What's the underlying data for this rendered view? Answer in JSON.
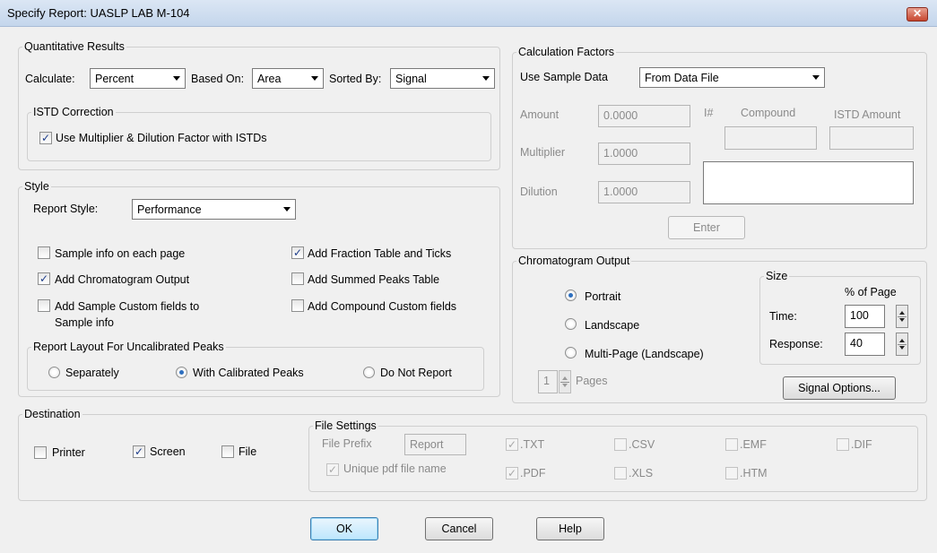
{
  "window": {
    "title": "Specify Report: UASLP LAB M-104",
    "close_glyph": "✕"
  },
  "quant": {
    "legend": "Quantitative Results",
    "calculate_label": "Calculate:",
    "calculate_value": "Percent",
    "based_on_label": "Based On:",
    "based_on_value": "Area",
    "sorted_by_label": "Sorted By:",
    "sorted_by_value": "Signal",
    "istd_legend": "ISTD Correction",
    "istd_check_label": "Use Multiplier & Dilution Factor with ISTDs",
    "istd_checked": true
  },
  "style": {
    "legend": "Style",
    "report_style_label": "Report Style:",
    "report_style_value": "Performance",
    "sample_info": "Sample info on each page",
    "add_chrom": "Add Chromatogram Output",
    "add_sample_custom_1": "Add Sample Custom fields to",
    "add_sample_custom_2": "Sample info",
    "add_fraction": "Add Fraction Table and Ticks",
    "add_summed": "Add Summed Peaks Table",
    "add_compound_custom": "Add Compound Custom fields",
    "layout_legend": "Report Layout For Uncalibrated Peaks",
    "separately": "Separately",
    "with_calibrated": "With Calibrated Peaks",
    "do_not_report": "Do Not Report"
  },
  "calc": {
    "legend": "Calculation Factors",
    "use_sample_label": "Use Sample Data",
    "use_sample_value": "From Data File",
    "amount_label": "Amount",
    "amount_value": "0.0000",
    "multiplier_label": "Multiplier",
    "multiplier_value": "1.0000",
    "dilution_label": "Dilution",
    "dilution_value": "1.0000",
    "hash_label": "I#",
    "compound_label": "Compound",
    "istd_amount_label": "ISTD Amount",
    "enter_label": "Enter"
  },
  "chrom": {
    "legend": "Chromatogram Output",
    "portrait": "Portrait",
    "landscape": "Landscape",
    "multipage": "Multi-Page (Landscape)",
    "pages_value": "1",
    "pages_label": "Pages",
    "size_legend": "Size",
    "pct_label": "% of Page",
    "time_label": "Time:",
    "time_value": "100",
    "response_label": "Response:",
    "response_value": "40",
    "signal_options": "Signal Options..."
  },
  "dest": {
    "legend": "Destination",
    "printer": "Printer",
    "screen": "Screen",
    "file": "File",
    "file_settings_legend": "File Settings",
    "file_prefix_label": "File Prefix",
    "file_prefix_value": "Report",
    "unique_pdf": "Unique pdf file name",
    "txt": ".TXT",
    "pdf": ".PDF",
    "csv": ".CSV",
    "xls": ".XLS",
    "emf": ".EMF",
    "htm": ".HTM",
    "dif": ".DIF"
  },
  "buttons": {
    "ok": "OK",
    "cancel": "Cancel",
    "help": "Help"
  },
  "check_glyph": "✓"
}
